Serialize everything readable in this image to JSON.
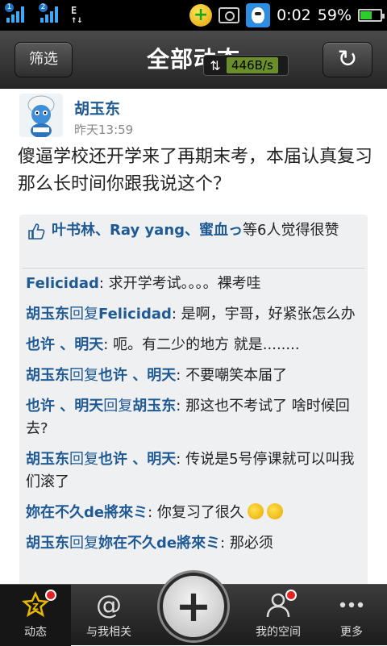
{
  "status_bar": {
    "sim1": "1",
    "sim2": "2",
    "net_label": "E",
    "time": "0:02",
    "battery": "59%",
    "battery_level": 0.59
  },
  "header": {
    "filter_label": "筛选",
    "title": "全部动态",
    "speed": "446B/s",
    "speed_icon": "updown-arrows-icon",
    "refresh_icon": "refresh-icon"
  },
  "post": {
    "author": "胡玉东",
    "time": "昨天13:59",
    "text": "傻逼学校还开学来了再期末考，本届认真复习那么长时间你跟我说这个？",
    "likes": {
      "names": "叶书林、Ray yang、蜜血っ",
      "suffix": "等6人觉得很赞"
    },
    "comments": [
      {
        "user": "Felicidad",
        "mid": "",
        "target": "",
        "text": ": 求开学考试。。。。裸考哇",
        "emoji": 0
      },
      {
        "user": "胡玉东",
        "mid": "回复",
        "target": "Felicidad",
        "text": ": 是啊，宇哥，好紧张怎么办",
        "emoji": 0
      },
      {
        "user": "也许 、明天",
        "mid": "",
        "target": "",
        "text": ": 呃。有二少的地方 就是........",
        "emoji": 0
      },
      {
        "user": "胡玉东",
        "mid": "回复",
        "target": "也许 、明天",
        "text": ": 不要嘲笑本届了",
        "emoji": 0
      },
      {
        "user": "也许 、明天",
        "mid": "回复",
        "target": "胡玉东",
        "text": ": 那这也不考试了 啥时候回去?",
        "emoji": 0
      },
      {
        "user": "胡玉东",
        "mid": "回复",
        "target": "也许 、明天",
        "text": ": 传说是5号停课就可以叫我们滚了",
        "emoji": 0
      },
      {
        "user": "妳在不久de將來ミ",
        "mid": "",
        "target": "",
        "text": ": 你复习了很久",
        "emoji": 2
      },
      {
        "user": "胡玉东",
        "mid": "回复",
        "target": "妳在不久de將來ミ",
        "text": ": 那必须",
        "emoji": 0
      }
    ]
  },
  "bottom_nav": {
    "items": [
      {
        "label": "动态",
        "icon": "star-icon",
        "active": true,
        "badge": true
      },
      {
        "label": "与我相关",
        "icon": "at-icon",
        "active": false,
        "badge": false
      },
      {
        "label": "我的空间",
        "icon": "person-icon",
        "active": false,
        "badge": true
      },
      {
        "label": "更多",
        "icon": "more-dots-icon",
        "active": false,
        "badge": false
      }
    ],
    "center_icon": "plus-icon"
  }
}
